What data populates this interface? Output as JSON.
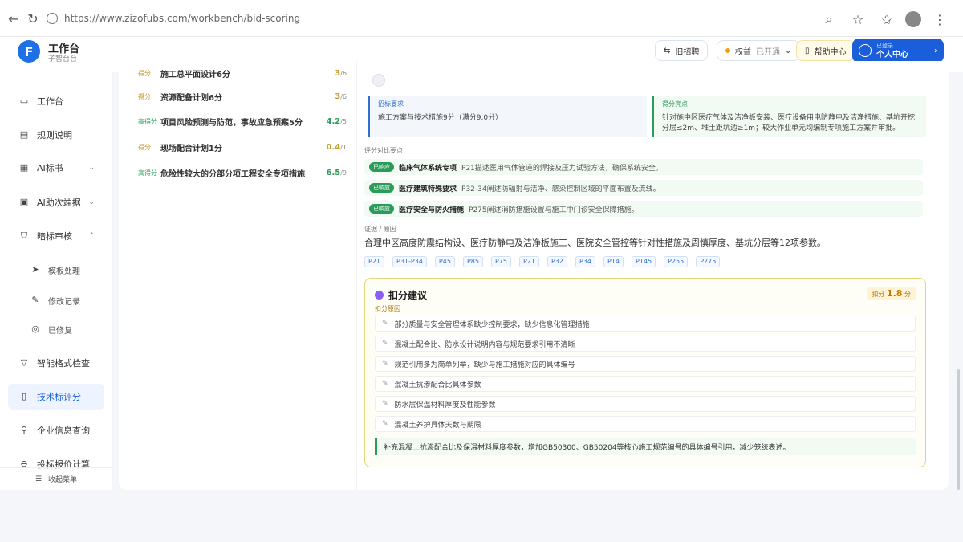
{
  "browser": {
    "url": "https://www.zizofubs.com/workbench/bid-scoring"
  },
  "app": {
    "logo_letter": "F",
    "title": "工作台",
    "subtitle": "子智台台"
  },
  "header": {
    "btn1": "旧招聘",
    "btn2": "权益",
    "btn2_sub": "已开通",
    "btn3": "帮助中心",
    "primary_top": "已登录",
    "primary_main": "个人中心"
  },
  "sidebar": {
    "items": [
      {
        "label": "工作台",
        "icon": "monitor-icon"
      },
      {
        "label": "规则说明",
        "icon": "document-icon"
      },
      {
        "label": "AI标书",
        "icon": "file-icon",
        "caret": "⌄"
      },
      {
        "label": "AI助次端据",
        "icon": "screen-icon",
        "caret": "⌄"
      },
      {
        "label": "暗标审核",
        "icon": "shield-icon",
        "caret": "⌃"
      },
      {
        "label": "模板处理",
        "icon": "send-icon",
        "sub": true
      },
      {
        "label": "修改记录",
        "icon": "edit-icon",
        "sub": true
      },
      {
        "label": "已修复",
        "icon": "check-circle-icon",
        "sub": true
      },
      {
        "label": "智能格式检查",
        "icon": "filter-icon"
      },
      {
        "label": "技术标评分",
        "icon": "file-check-icon",
        "active": true
      },
      {
        "label": "企业信息查询",
        "icon": "search-icon"
      },
      {
        "label": "投标报价计算",
        "icon": "calculator-icon"
      }
    ],
    "footer": "收起菜单"
  },
  "scores": [
    {
      "tag": "得分",
      "name": "施工总平面设计6分",
      "value": "3",
      "total": "/6",
      "green": false
    },
    {
      "tag": "得分",
      "name": "资源配备计划6分",
      "value": "3",
      "total": "/6",
      "green": false
    },
    {
      "tag": "高得分",
      "name": "项目风险预测与防范，事故应急预案5分",
      "value": "4.2",
      "total": "/5",
      "green": true
    },
    {
      "tag": "得分",
      "name": "现场配合计划1分",
      "value": "0.4",
      "total": "/1",
      "green": false
    },
    {
      "tag": "高得分",
      "name": "危险性较大的分部分项工程安全专项措施",
      "value": "6.5",
      "total": "/9",
      "green": true
    }
  ],
  "requirements": {
    "left_label": "招标要求",
    "left_text": "施工方案与技术措施9分（满分9.0分）",
    "right_label": "得分亮点",
    "right_text": "针对施中区医疗气体及洁净板安装、医疗设备用电防静电及洁净措施、基坑开挖分层≤2m、堆土距坑边≥1m；较大作业单元均编制专项施工方案并审批。"
  },
  "checks_label": "评分对比要点",
  "checks": [
    {
      "pill": "已响应",
      "title": "临床气体系统专项",
      "text": "P21描述医用气体管道的焊接及压力试验方法，确保系统安全。"
    },
    {
      "pill": "已响应",
      "title": "医疗建筑特殊要求",
      "text": "P32-34阐述防辐射与洁净、感染控制区域的平面布置及流线。"
    },
    {
      "pill": "已响应",
      "title": "医疗安全与防火措施",
      "text": "P275阐述消防措施设置与施工中门诊安全保障措施。"
    }
  ],
  "summary_label": "证据 / 原因",
  "summary": "合理中区高度防震结构设、医疗防静电及洁净板施工、医院安全管控等针对性措施及周慎厚度、基坑分层等12项参数。",
  "chips": [
    "P21",
    "P31-P34",
    "P45",
    "P85",
    "P75",
    "P21",
    "P32",
    "P34",
    "P14",
    "P145",
    "P255",
    "P275"
  ],
  "deduct": {
    "title": "扣分建议",
    "badge_label": "扣分",
    "badge_value": "1.8",
    "badge_unit": "分",
    "sub": "扣分原因",
    "items": [
      "部分质量与安全管理体系缺少控制要求，缺少信息化管理措施",
      "混凝土配合比、防水设计说明内容与规范要求引用不清晰",
      "规范引用多为简单列举，缺少与施工措施对应的具体编号",
      "混凝土抗渗配合比具体参数",
      "防水层保温材料厚度及性能参数",
      "混凝土养护具体天数与期限"
    ],
    "footer": "补充混凝土抗渗配合比及保温材料厚度参数，增加GB50300、GB50204等核心施工规范编号的具体编号引用，减少笼统表述。"
  }
}
